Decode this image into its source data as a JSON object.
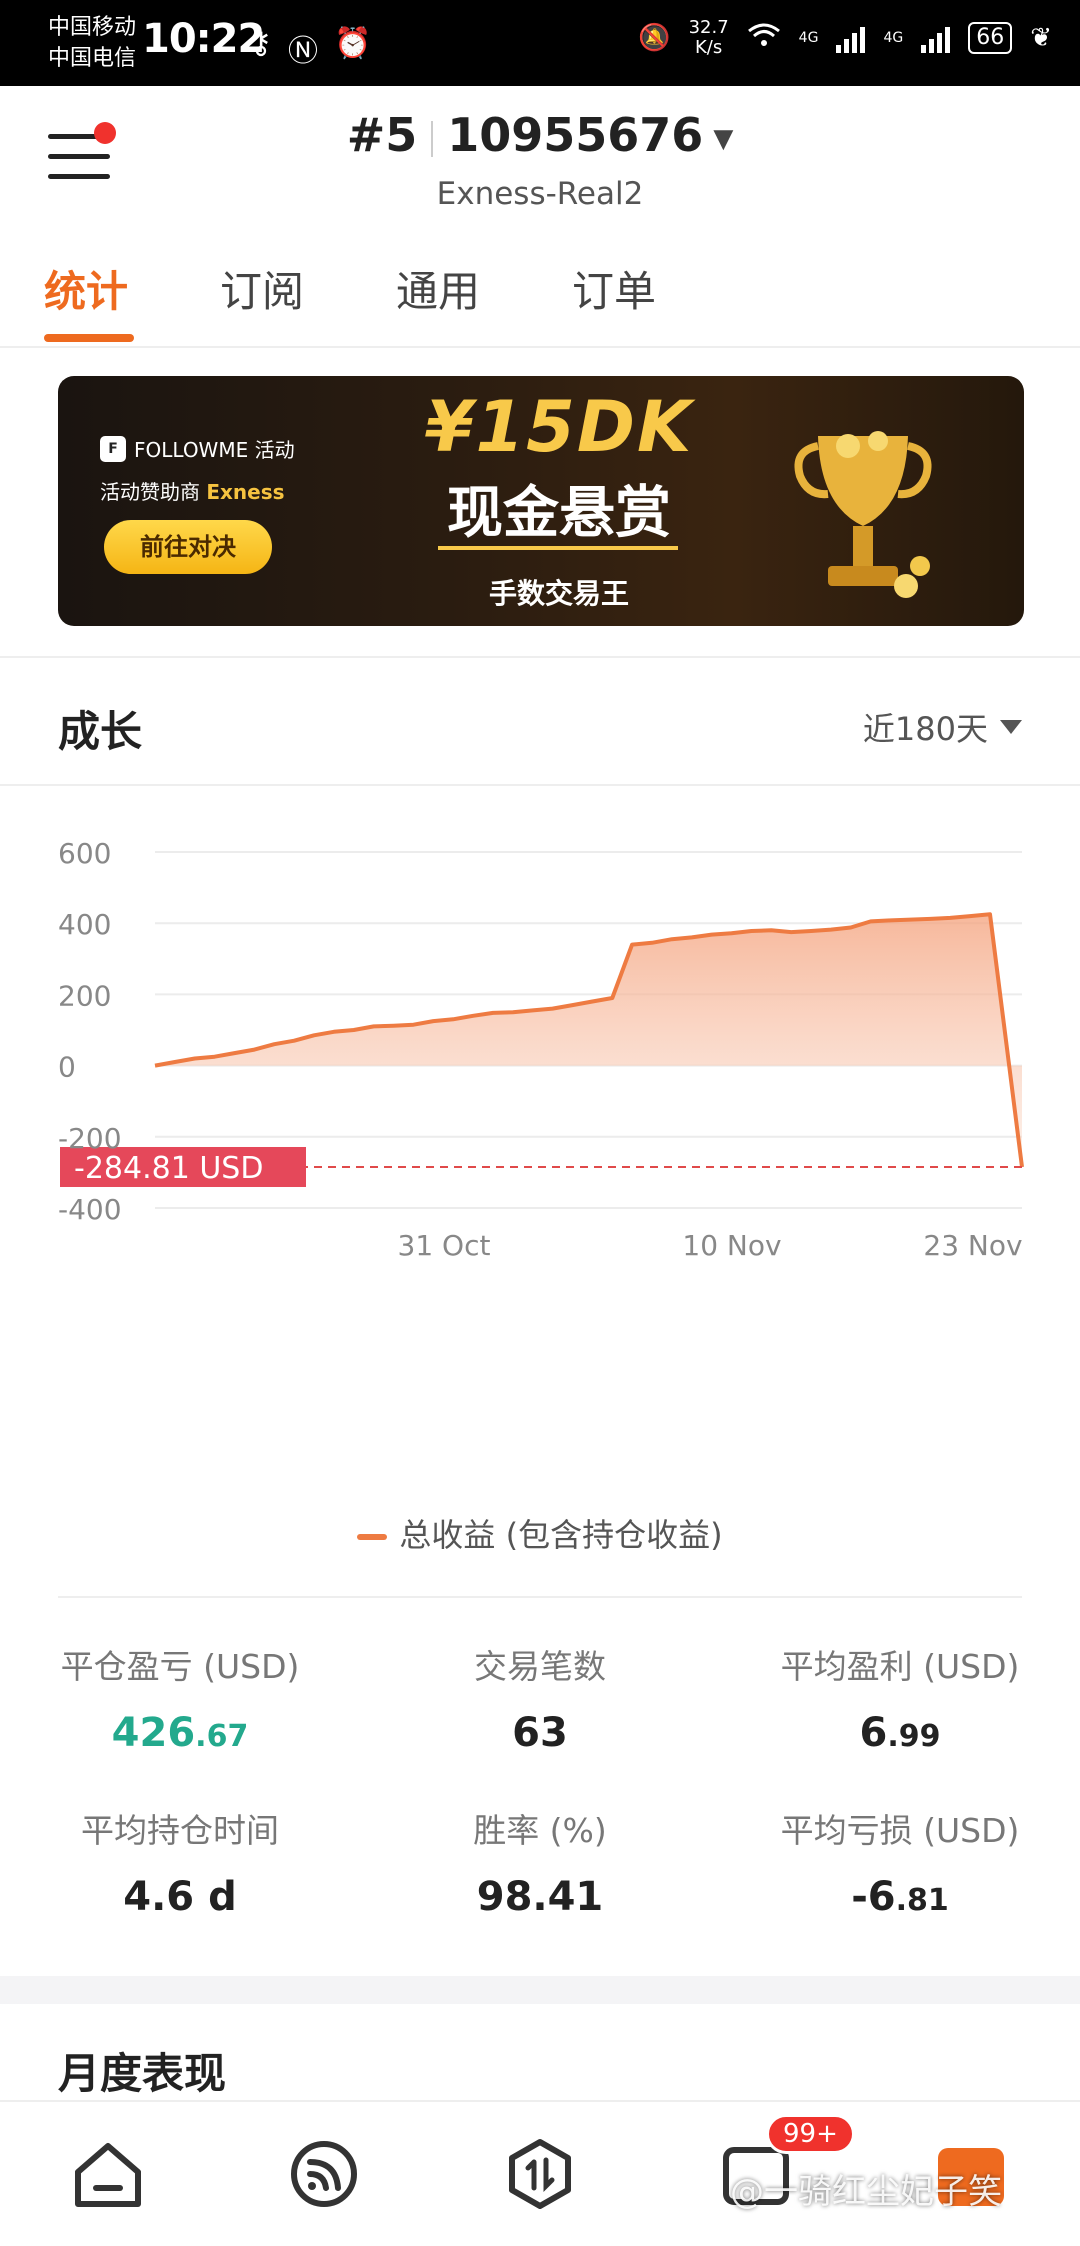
{
  "status_bar": {
    "carrier1": "中国移动",
    "carrier2": "中国电信",
    "time": "10:22",
    "speed_value": "32.7",
    "speed_unit": "K/s",
    "network1": "4G",
    "network2": "4G",
    "battery": "66"
  },
  "header": {
    "rank": "#5",
    "account_number": "10955676",
    "broker": "Exness-Real2"
  },
  "tabs": [
    "统计",
    "订阅",
    "通用",
    "订单"
  ],
  "banner": {
    "brand": "FOLLOWME 活动",
    "sponsor_prefix": "活动赞助商",
    "sponsor_name": "Exness",
    "button": "前往对决",
    "amount": "¥15DK",
    "headline": "现金悬赏",
    "subline": "手数交易王"
  },
  "growth": {
    "title": "成长",
    "range_selector": "近180天"
  },
  "chart_data": {
    "type": "area",
    "y_ticks": [
      "600",
      "400",
      "200",
      "0",
      "-200",
      "-400"
    ],
    "x_ticks": [
      "31 Oct",
      "10 Nov",
      "23 Nov"
    ],
    "ylim": [
      -400,
      600
    ],
    "current_value_label": "-284.81 USD",
    "current_value": -284.81,
    "series": [
      {
        "name": "总收益 (包含持仓收益)",
        "values": [
          0,
          10,
          20,
          25,
          35,
          45,
          60,
          70,
          85,
          95,
          100,
          110,
          112,
          115,
          125,
          130,
          140,
          148,
          150,
          155,
          160,
          170,
          180,
          190,
          340,
          345,
          355,
          360,
          368,
          372,
          378,
          380,
          375,
          378,
          382,
          388,
          405,
          408,
          410,
          412,
          415,
          420,
          425,
          -284.81
        ]
      }
    ],
    "grid": true,
    "legend_position": "bottom"
  },
  "stats": [
    {
      "label": "平仓盈亏 (USD)",
      "int": "426",
      "dec": ".67",
      "color": "green"
    },
    {
      "label": "交易笔数",
      "int": "63",
      "dec": "",
      "color": "default"
    },
    {
      "label": "平均盈利 (USD)",
      "int": "6",
      "dec": ".99",
      "color": "default"
    },
    {
      "label": "平均持仓时间",
      "int": "4.6 d",
      "dec": "",
      "color": "default"
    },
    {
      "label": "胜率 (%)",
      "int": "98.41",
      "dec": "",
      "color": "default"
    },
    {
      "label": "平均亏损 (USD)",
      "int": "-6",
      "dec": ".81",
      "color": "default"
    }
  ],
  "monthly_title": "月度表现",
  "bottom_nav": {
    "badge": "99+",
    "watermark": "@一骑红尘妃子笑"
  }
}
